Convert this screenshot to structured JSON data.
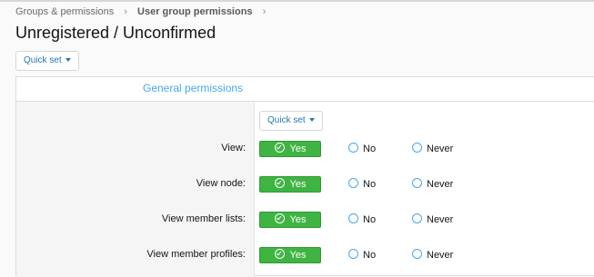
{
  "breadcrumb": {
    "items": [
      "Groups & permissions",
      "User group permissions"
    ],
    "separator": "›"
  },
  "page": {
    "title": "Unregistered / Unconfirmed"
  },
  "quick_set": {
    "label": "Quick set"
  },
  "panel": {
    "header": "General permissions",
    "quick_set_label": "Quick set",
    "options": {
      "yes": "Yes",
      "no": "No",
      "never": "Never"
    },
    "rows": [
      {
        "label": "View:",
        "selected": "Yes"
      },
      {
        "label": "View node:",
        "selected": "Yes"
      },
      {
        "label": "View member lists:",
        "selected": "Yes"
      },
      {
        "label": "View member profiles:",
        "selected": "Yes"
      }
    ]
  },
  "colors": {
    "accent": "#2577b1",
    "link": "#47a7eb",
    "yes_green": "#3fb443"
  }
}
